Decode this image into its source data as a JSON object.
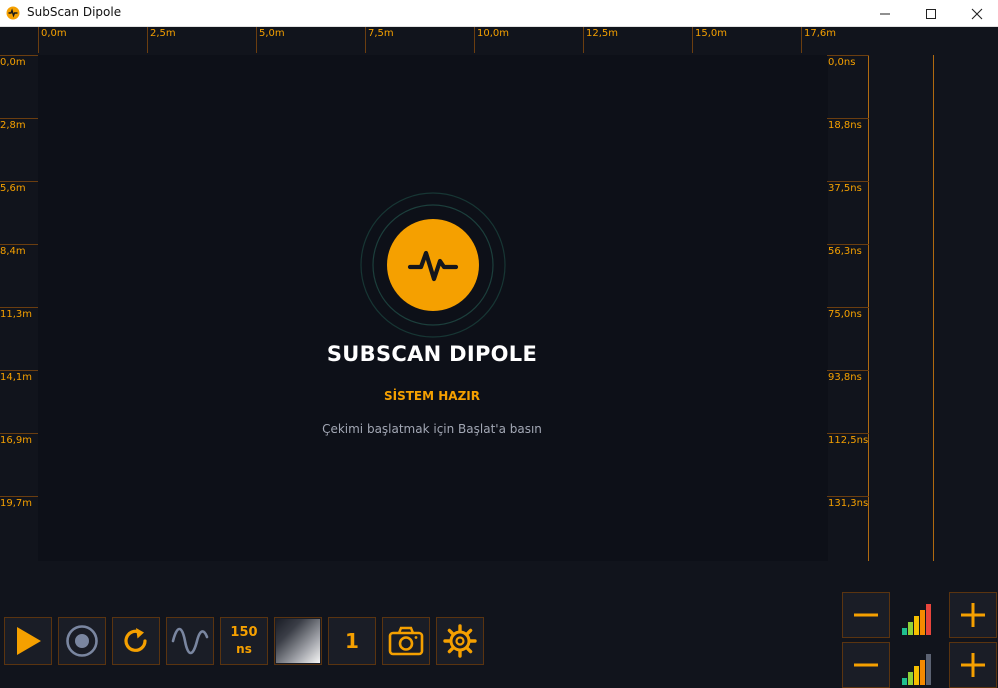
{
  "window": {
    "title": "SubScan Dipole"
  },
  "rulers": {
    "distance_top": [
      "0,0m",
      "2,5m",
      "5,0m",
      "7,5m",
      "10,0m",
      "12,5m",
      "15,0m",
      "17,6m"
    ],
    "depth_left": [
      "0,0m",
      "2,8m",
      "5,6m",
      "8,4m",
      "11,3m",
      "14,1m",
      "16,9m",
      "19,7m"
    ],
    "time_right": [
      "0,0ns",
      "18,8ns",
      "37,5ns",
      "56,3ns",
      "75,0ns",
      "93,8ns",
      "112,5ns",
      "131,3ns"
    ]
  },
  "center": {
    "app_name": "SUBSCAN DIPOLE",
    "status": "SİSTEM HAZIR",
    "hint": "Çekimi başlatmak için Başlat'a basın"
  },
  "toolbar": {
    "time_window_value": "150",
    "time_window_unit": "ns",
    "stack_value": "1",
    "icons": [
      "play-icon",
      "record-icon",
      "refresh-icon",
      "wave-icon",
      "gradient-icon",
      "camera-icon",
      "gear-icon"
    ]
  },
  "gain_controls": {
    "bar_colors_row1": [
      "#1fbf8f",
      "#8fd23a",
      "#f5c000",
      "#f58a00",
      "#e8453c"
    ],
    "bar_colors_row2": [
      "#1fbf8f",
      "#8fd23a",
      "#f5c000",
      "#f58a00",
      "#5b6272"
    ]
  },
  "colors": {
    "accent": "#f5a000",
    "background": "#11141c",
    "canvas": "#0d1018"
  }
}
